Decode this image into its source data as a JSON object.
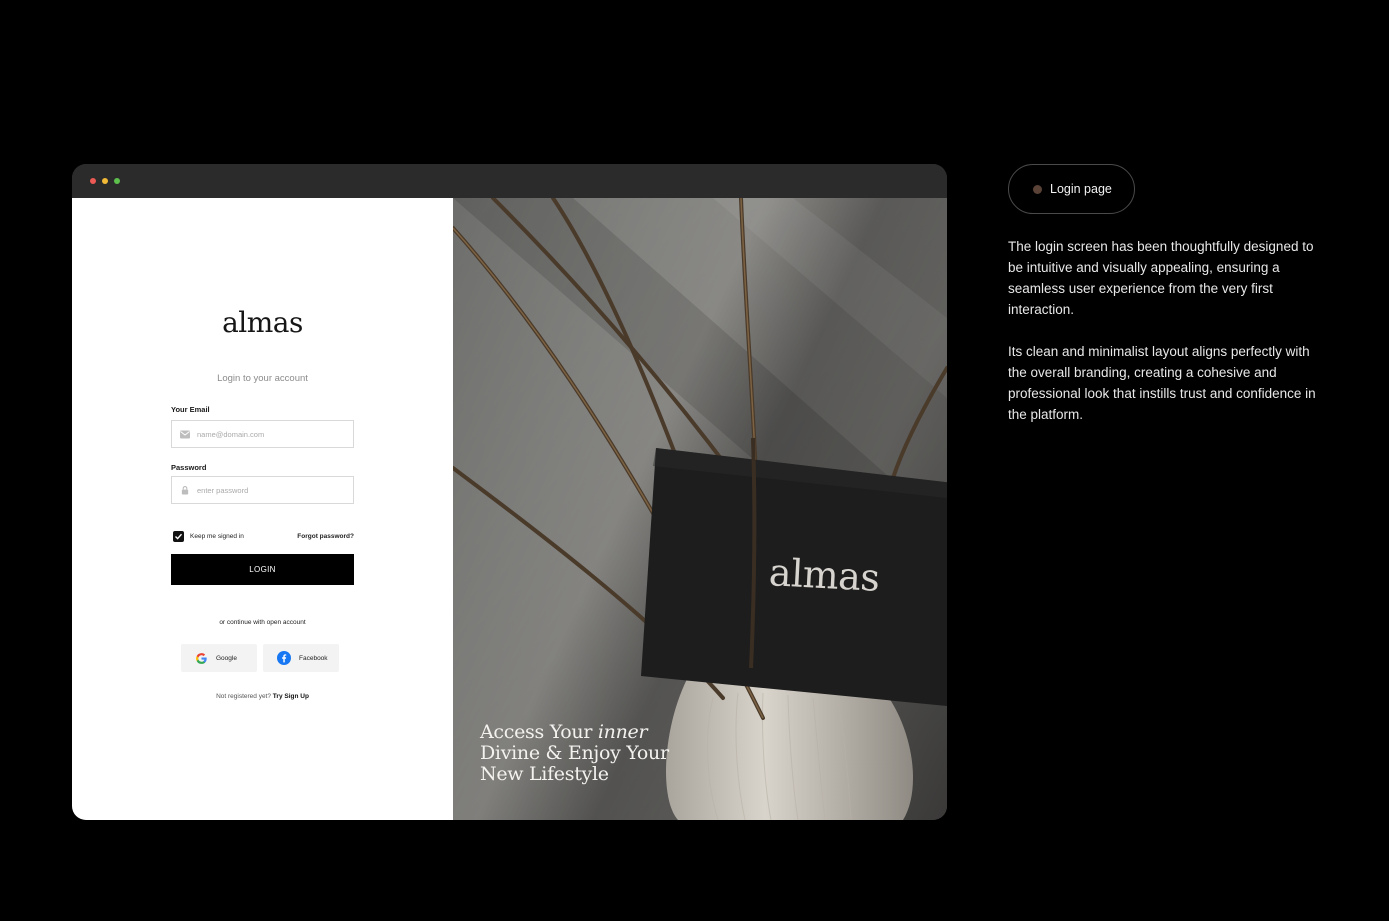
{
  "window": {
    "traffic_lights": [
      "#ed5a55",
      "#f1b935",
      "#5ec04c"
    ]
  },
  "login": {
    "logo": "almas",
    "subtitle": "Login to your account",
    "email_label": "Your Email",
    "email_placeholder": "name@domain.com",
    "email_icon": "mail-icon",
    "password_label": "Password",
    "password_placeholder": "enter password",
    "password_icon": "lock-icon",
    "keep_signed_in": "Keep me signed in",
    "keep_signed_in_checked": true,
    "forgot_password": "Forgot password?",
    "login_button": "LOGIN",
    "or_continue": "or continue with open account",
    "google_label": "Google",
    "facebook_label": "Facebook",
    "not_registered": "Not registered yet?",
    "sign_up_link": "Try Sign Up"
  },
  "hero": {
    "card_logo": "almas",
    "tagline_part1": "Access Your ",
    "tagline_italic": "inner",
    "tagline_line2": "Divine & Enjoy Your",
    "tagline_line3": "New Lifestyle"
  },
  "sidebar": {
    "badge_label": "Login page",
    "badge_dot_color": "#5a4236",
    "paragraph1": "The login screen has been thoughtfully designed to be intuitive and visually appealing, ensuring a seamless user experience from the very first interaction.",
    "paragraph2": "Its clean and minimalist layout aligns perfectly with the overall branding, creating a cohesive and professional look that instills trust and confidence in the platform."
  },
  "colors": {
    "background": "#000000",
    "button": "#000000",
    "accent_text": "#ffffff"
  }
}
